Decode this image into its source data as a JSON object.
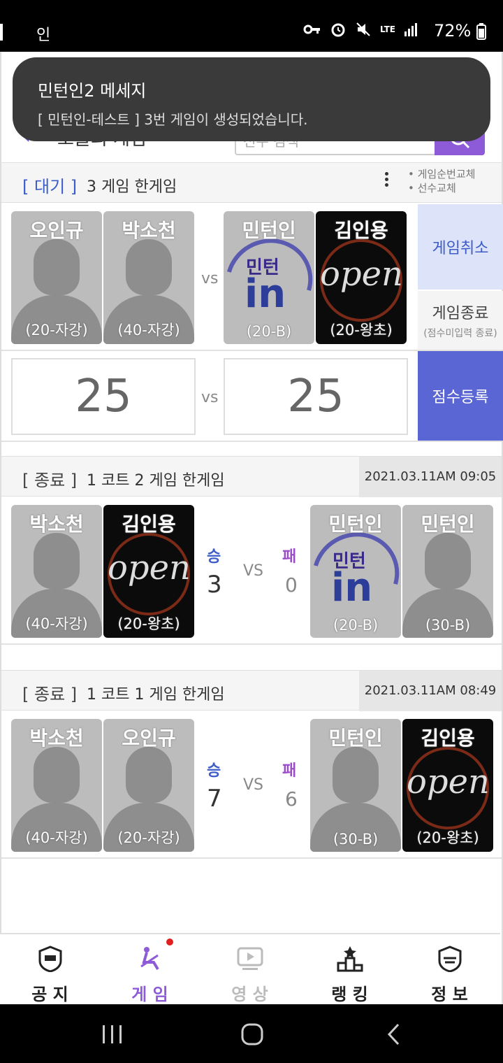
{
  "status_bar": {
    "carrier": "인",
    "battery": "72%",
    "icons": [
      "key-icon",
      "alarm-icon",
      "mute-icon",
      "lte-icon",
      "signal-icon",
      "battery-icon"
    ],
    "lte_text": "LTE"
  },
  "header": {
    "title": "오늘의 게임",
    "search_placeholder": "선수 검색"
  },
  "toast": {
    "title": "민턴인2 메세지",
    "message": "[ 민턴인-테스트 ] 3번 게임이 생성되었습니다."
  },
  "waiting_game": {
    "status": "[ 대기 ]",
    "info": "3 게임  한게임",
    "notes": [
      "• 게임순번교체",
      "• 선수교체"
    ],
    "team_a": [
      {
        "name": "오인규",
        "level": "(20-자강)"
      },
      {
        "name": "박소천",
        "level": "(40-자강)"
      }
    ],
    "team_b": [
      {
        "name": "민턴인",
        "level": "(20-B)"
      },
      {
        "name": "김인용",
        "level": "(20-왕초)"
      }
    ],
    "vs": "vs",
    "score_a": "25",
    "score_b": "25",
    "cancel_label": "게임취소",
    "end_label": "게임종료",
    "end_sub": "(점수미입력 종료)",
    "score_label": "점수등록"
  },
  "finished_games": [
    {
      "status": "[ 종료 ]",
      "info": "1 코트  2 게임  한게임",
      "date": "2021.03.11AM 09:05",
      "team_a": [
        {
          "name": "박소천",
          "level": "(40-자강)"
        },
        {
          "name": "김인용",
          "level": "(20-왕초)"
        }
      ],
      "team_b": [
        {
          "name": "민턴인",
          "level": "(20-B)"
        },
        {
          "name": "민턴인",
          "level": "(30-B)"
        }
      ],
      "win_label": "승",
      "lose_label": "패",
      "win_score": "3",
      "lose_score": "0",
      "vs": "VS"
    },
    {
      "status": "[ 종료 ]",
      "info": "1 코트  1 게임  한게임",
      "date": "2021.03.11AM 08:49",
      "team_a": [
        {
          "name": "박소천",
          "level": "(40-자강)"
        },
        {
          "name": "오인규",
          "level": "(20-자강)"
        }
      ],
      "team_b": [
        {
          "name": "민턴인",
          "level": "(30-B)"
        },
        {
          "name": "김인용",
          "level": "(20-왕초)"
        }
      ],
      "win_label": "승",
      "lose_label": "패",
      "win_score": "7",
      "lose_score": "6",
      "vs": "VS"
    }
  ],
  "card_image_text": {
    "open": "open",
    "logo_word": "민턴",
    "logo_in": "in"
  },
  "bottom_nav": [
    {
      "label": "공 지",
      "icon": "notice-icon"
    },
    {
      "label": "게 임",
      "icon": "game-icon"
    },
    {
      "label": "영 상",
      "icon": "video-icon"
    },
    {
      "label": "랭 킹",
      "icon": "ranking-icon"
    },
    {
      "label": "정 보",
      "icon": "info-icon"
    }
  ],
  "colors": {
    "accent": "#8e5bd8",
    "blue": "#3b5cc9",
    "score_button": "#5a66d4"
  }
}
